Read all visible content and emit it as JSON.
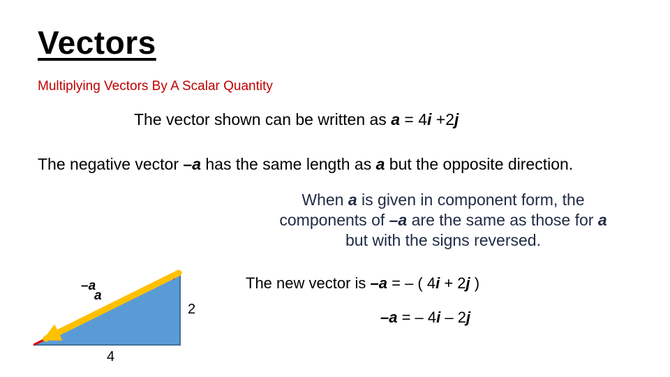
{
  "slide": {
    "title": "Vectors",
    "subtitle": "Multiplying Vectors By A Scalar Quantity",
    "line1": {
      "prefix": "The vector shown can be written as ",
      "vector": "a",
      "equals": " = 4",
      "i": "i",
      "plus": " +2",
      "j": "j"
    },
    "line2": {
      "p1": "The negative vector ",
      "neg_vector": "–a",
      "p2": " has the same length as ",
      "vector": "a",
      "p3": " but the opposite direction."
    },
    "paragraph": {
      "p1": "When ",
      "v1": "a",
      "p2": " is given in component form, the components of ",
      "v2": "–a",
      "p3": " are the same as those for ",
      "v3": "a",
      "p4": " but with the signs reversed."
    },
    "new_vector": {
      "p1": "The new vector is ",
      "neg_vector": "–a",
      "p2": " =  – ( 4",
      "i": "i",
      "p3": "  + 2",
      "j": "j",
      "p4": " )"
    },
    "result": {
      "neg_vector": "–a",
      "p1": " = – 4",
      "i": "i",
      "p2": " – 2",
      "j": "j"
    }
  },
  "diagram": {
    "label_neg_a": "–a",
    "label_a": "a",
    "vertical_component": "2",
    "horizontal_component": "4",
    "colors": {
      "triangle_fill": "#5b9bd5",
      "triangle_edge": "#41719c",
      "vector_a": "#e00000",
      "vector_neg_a": "#ffc000"
    }
  },
  "colors": {
    "subtitle": "#c00000",
    "paragraph": "#1f2a44"
  }
}
